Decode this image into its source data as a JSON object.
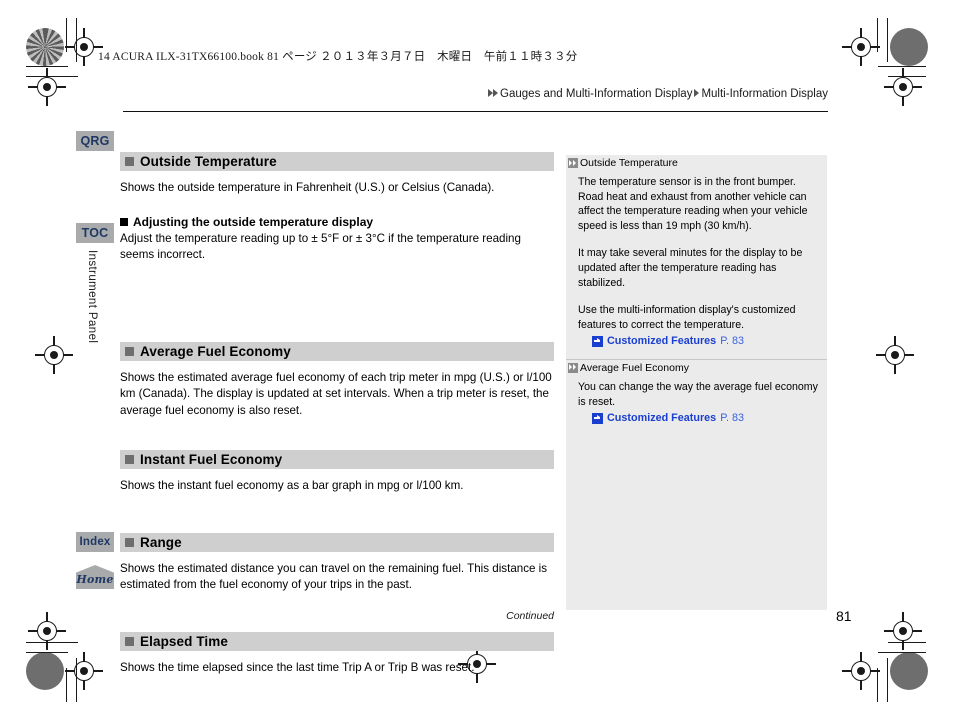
{
  "print": {
    "book_line": "14 ACURA ILX-31TX66100.book  81 ページ  ２０１３年３月７日　木曜日　午前１１時３３分"
  },
  "breadcrumb": {
    "parent": "Gauges and Multi-Information Display",
    "current": "Multi-Information Display"
  },
  "sidenav": {
    "qrg": "QRG",
    "toc": "TOC",
    "index": "Index",
    "home": "Home",
    "chapter": "Instrument Panel"
  },
  "sections": [
    {
      "title": "Outside Temperature",
      "body": "Shows the outside temperature in Fahrenheit (U.S.) or Celsius (Canada).",
      "subheading": "Adjusting the outside temperature display",
      "sub_body": "Adjust the temperature reading up to ± 5°F or ± 3°C if the temperature reading seems incorrect."
    },
    {
      "title": "Average Fuel Economy",
      "body": "Shows the estimated average fuel economy of each trip meter in mpg (U.S.) or l/100 km (Canada). The display is updated at set intervals. When a trip meter is reset, the average fuel economy is also reset."
    },
    {
      "title": "Instant Fuel Economy",
      "body": "Shows the instant fuel economy as a bar graph in mpg or l/100 km."
    },
    {
      "title": "Range",
      "body": "Shows the estimated distance you can travel on the remaining fuel. This distance is estimated from the fuel economy of your trips in the past."
    },
    {
      "title": "Elapsed Time",
      "body": "Shows the time elapsed since the last time Trip A or Trip B was reset."
    }
  ],
  "continued": "Continued",
  "notes": [
    {
      "title": "Outside Temperature",
      "paragraphs": [
        "The temperature sensor is in the front bumper. Road heat and exhaust from another vehicle can affect the temperature reading when your vehicle speed is less than 19 mph (30 km/h).",
        "It may take several minutes for the display to be updated after the temperature reading has stabilized.",
        "Use the multi-information display's customized features to correct the temperature."
      ],
      "link": {
        "label": "Customized Features",
        "page": "P. 83"
      }
    },
    {
      "title": "Average Fuel Economy",
      "paragraphs": [
        "You can change the way the average fuel economy is reset."
      ],
      "link": {
        "label": "Customized Features",
        "page": "P. 83"
      }
    }
  ],
  "page_number": "81",
  "colors": {
    "tab_bg": "#a8aaac",
    "tab_text": "#1f3864",
    "section_head_bg": "#cfcfcf",
    "note_panel_bg": "#ebebeb",
    "link_blue": "#1a3fd0"
  }
}
